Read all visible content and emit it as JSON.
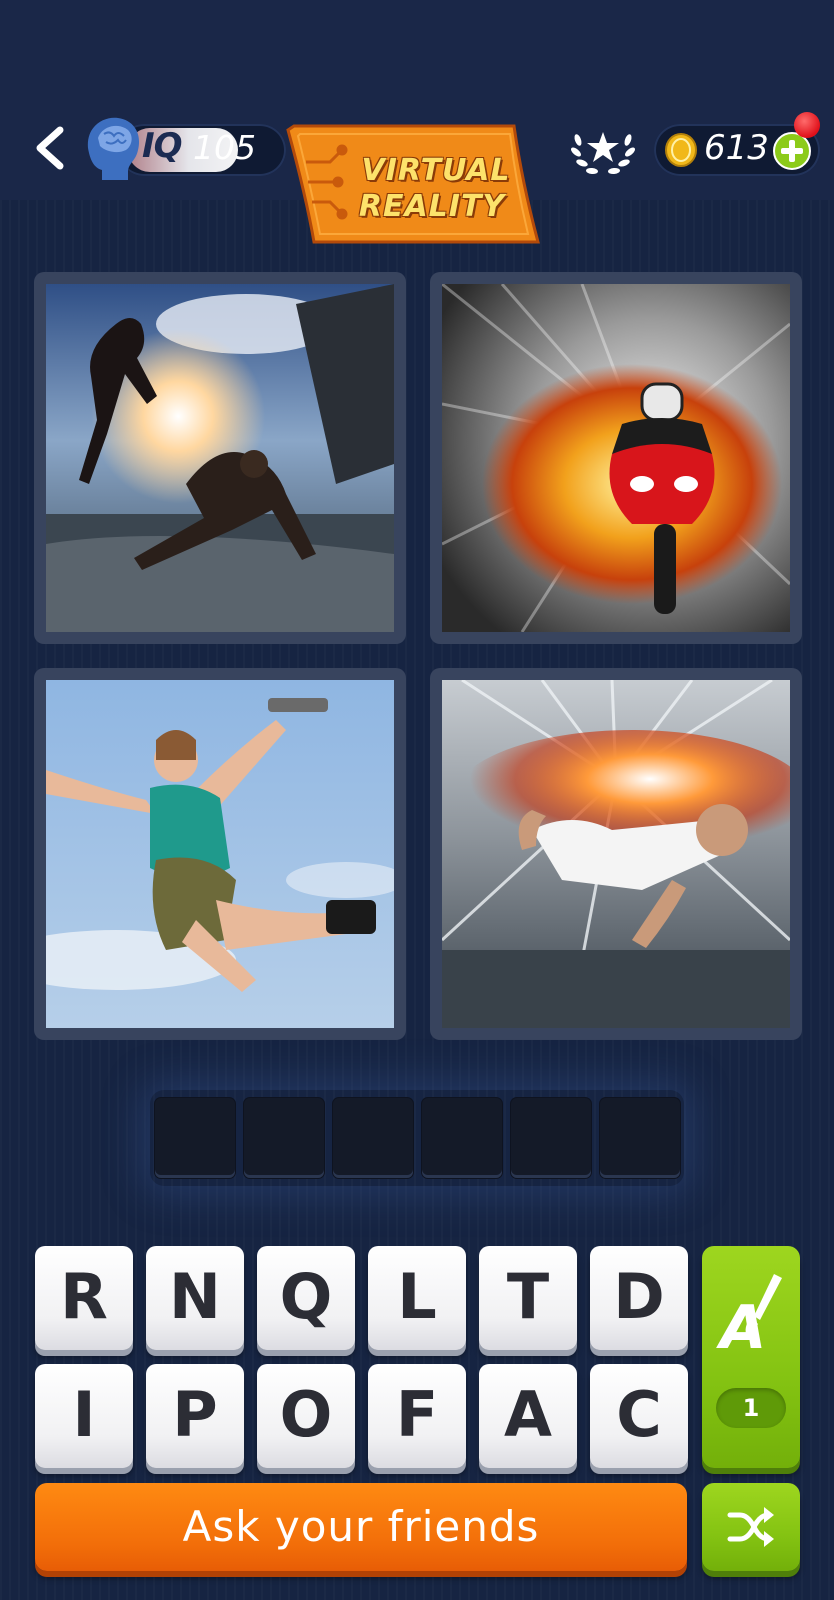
{
  "header": {
    "iq_label": "IQ",
    "iq_value": "105",
    "level_banner": {
      "line1": "VIRTUAL",
      "line2": "REALITY"
    },
    "coins": "613",
    "icons": [
      "back-arrow-icon",
      "brain-head-icon",
      "laurel-star-icon",
      "coin-icon",
      "plus-icon"
    ]
  },
  "puzzle": {
    "images": [
      {
        "name": "fight-scene-photo"
      },
      {
        "name": "motorcycle-explosion-photo"
      },
      {
        "name": "woman-jumping-with-gun-photo"
      },
      {
        "name": "man-crawling-explosion-photo"
      }
    ],
    "answer_length": 6
  },
  "keyboard": {
    "row1": [
      "R",
      "N",
      "Q",
      "L",
      "T",
      "D"
    ],
    "row2": [
      "I",
      "P",
      "O",
      "F",
      "A",
      "C"
    ],
    "hint_count": "1"
  },
  "actions": {
    "ask_friends_label": "Ask your friends"
  },
  "colors": {
    "background": "#15213d",
    "accent_orange": "#f26e09",
    "accent_green": "#84c312",
    "banner_orange": "#f08a18"
  }
}
